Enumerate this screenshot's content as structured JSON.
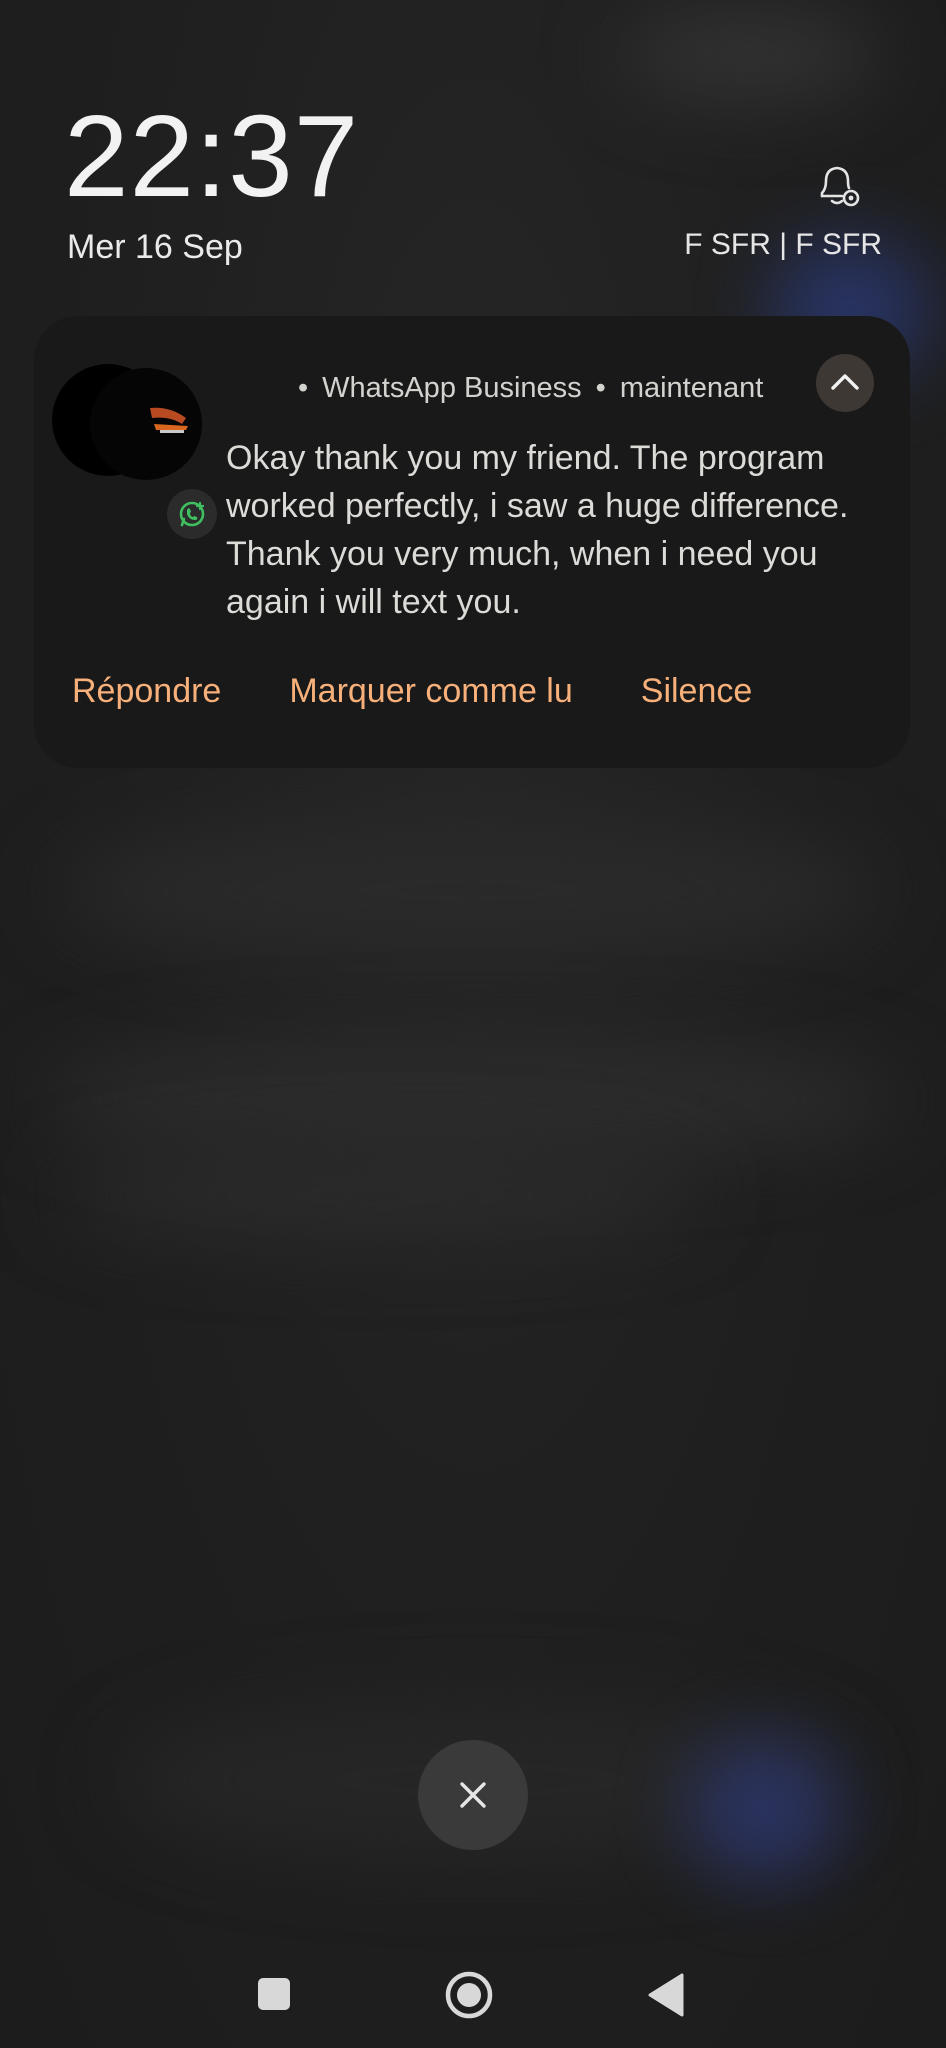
{
  "lockscreen": {
    "time": "22:37",
    "date": "Mer 16 Sep",
    "carrier": "F SFR | F SFR"
  },
  "notification": {
    "app_name": "WhatsApp Business",
    "timestamp": "maintenant",
    "message": "Okay thank you my friend. The program worked perfectly, i saw a huge difference. Thank you very much, when i need you again i will text you.",
    "actions": {
      "reply": "Répondre",
      "mark_read": "Marquer comme lu",
      "mute": "Silence"
    },
    "accent_color": "#f7b07a",
    "badge_color": "#3fbf5f"
  },
  "icons": {
    "bell": "bell-settings-icon",
    "collapse": "chevron-up-icon",
    "dismiss": "close-icon",
    "nav": [
      "square-recents-icon",
      "circle-home-icon",
      "triangle-back-icon"
    ]
  }
}
